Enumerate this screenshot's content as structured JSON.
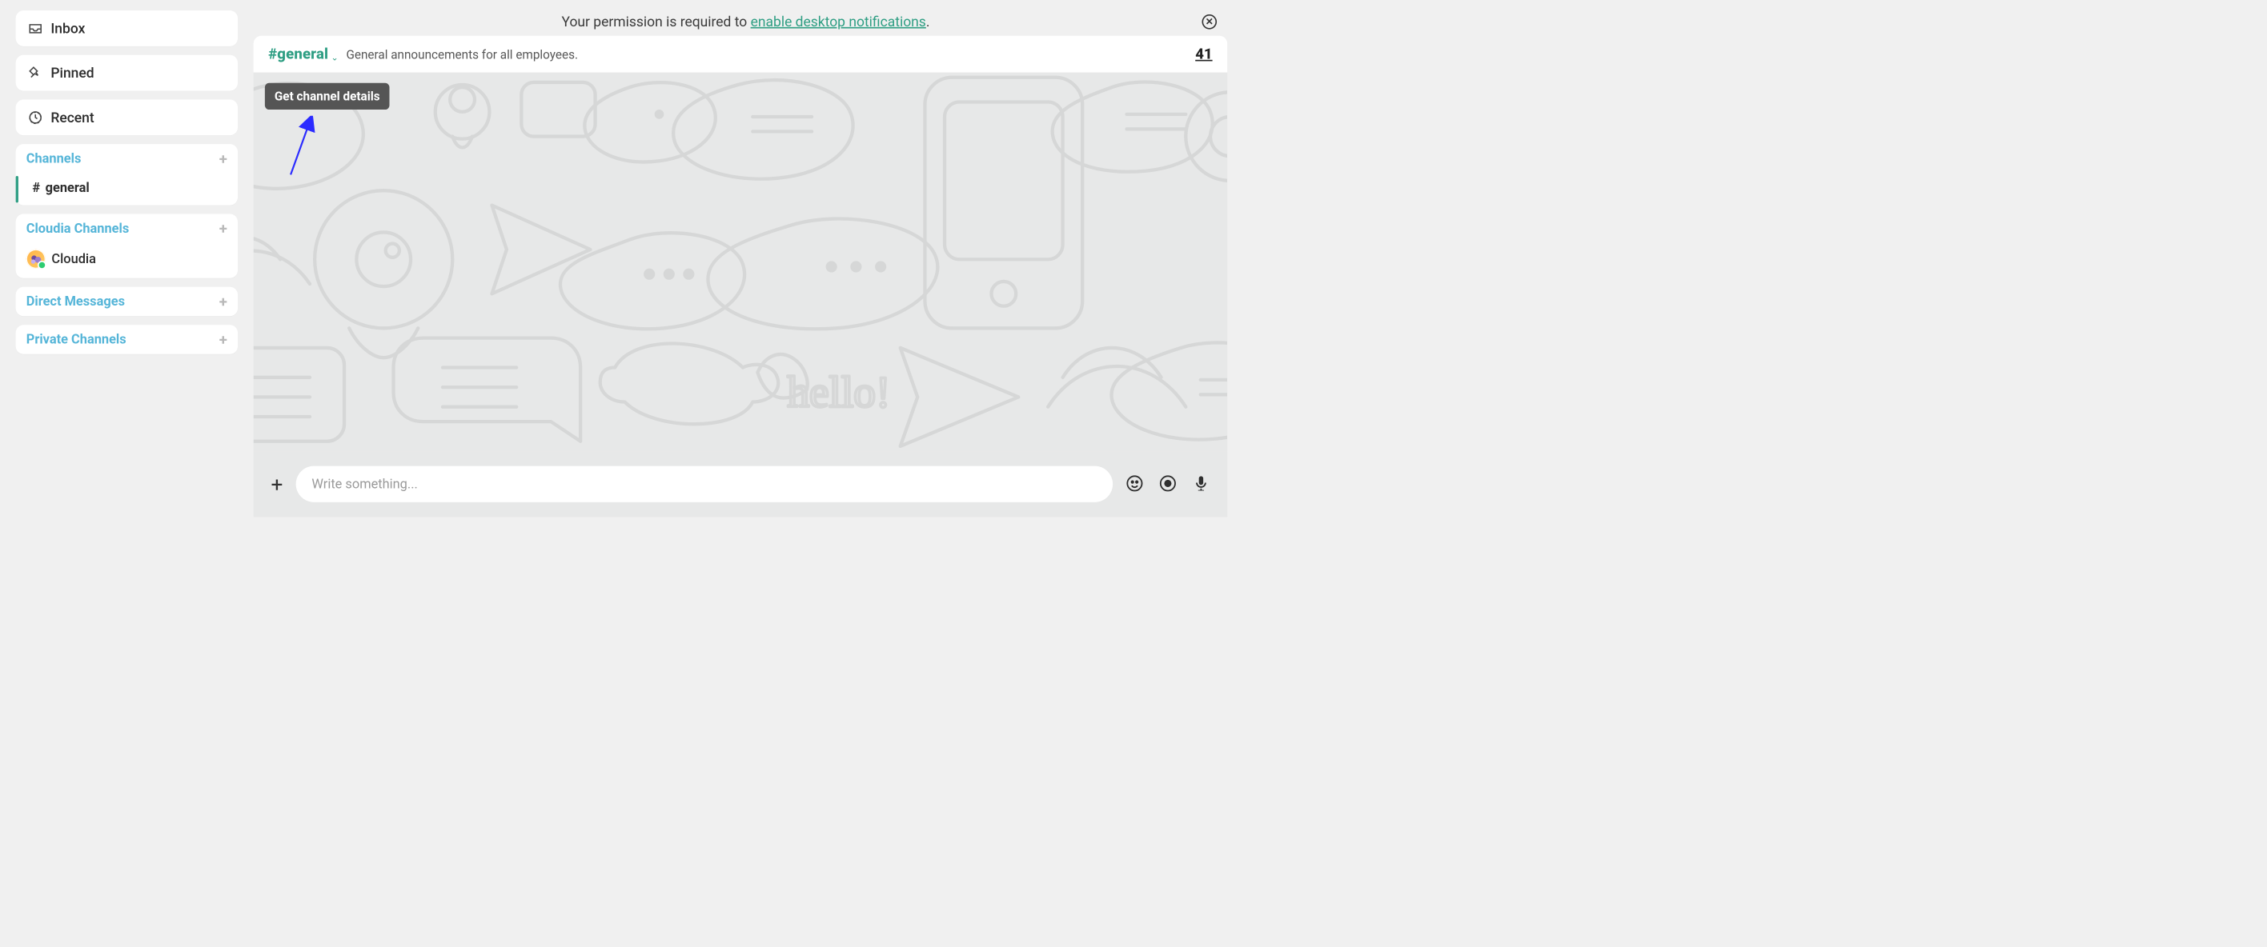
{
  "sidebar": {
    "nav": {
      "inbox": "Inbox",
      "pinned": "Pinned",
      "recent": "Recent"
    },
    "icons": {
      "inbox": "inbox-icon",
      "pinned": "pin-icon",
      "recent": "clock-icon"
    },
    "channels": {
      "label": "Channels",
      "items": [
        {
          "name": "general"
        }
      ]
    },
    "cloudia": {
      "label": "Cloudia Channels",
      "items": [
        {
          "name": "Cloudia"
        }
      ]
    },
    "dms": {
      "label": "Direct Messages"
    },
    "private": {
      "label": "Private Channels"
    }
  },
  "notification": {
    "prefix": "Your permission is required to ",
    "link": "enable desktop notifications",
    "suffix": "."
  },
  "header": {
    "channel_name": "#general",
    "description": "General announcements for all employees.",
    "member_count": "41",
    "tooltip": "Get channel details"
  },
  "composer": {
    "placeholder": "Write something..."
  },
  "colors": {
    "accent": "#2e9e83",
    "link": "#55b5d8"
  }
}
